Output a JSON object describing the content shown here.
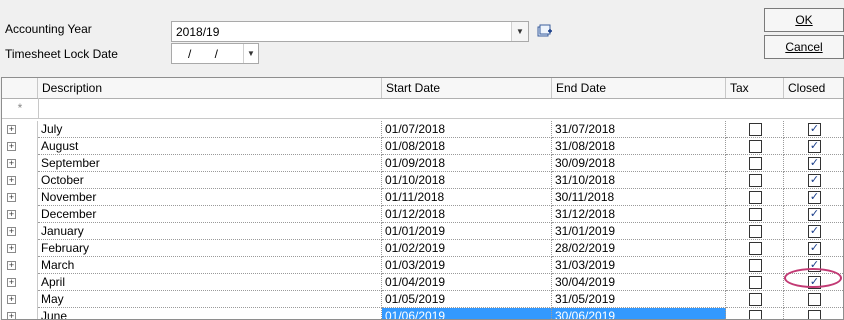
{
  "form": {
    "accounting_year_label": "Accounting Year",
    "accounting_year_value": "2018/19",
    "timesheet_lock_label": "Timesheet Lock Date",
    "timesheet_lock_value": "/ /",
    "ok_label": "OK",
    "cancel_label": "Cancel"
  },
  "grid": {
    "columns": [
      "Description",
      "Start Date",
      "End Date",
      "Tax",
      "Closed"
    ],
    "new_row_marker": "*",
    "rows": [
      {
        "description": "July",
        "start": "01/07/2018",
        "end": "31/07/2018",
        "tax": false,
        "closed": true
      },
      {
        "description": "August",
        "start": "01/08/2018",
        "end": "31/08/2018",
        "tax": false,
        "closed": true
      },
      {
        "description": "September",
        "start": "01/09/2018",
        "end": "30/09/2018",
        "tax": false,
        "closed": true
      },
      {
        "description": "October",
        "start": "01/10/2018",
        "end": "31/10/2018",
        "tax": false,
        "closed": true
      },
      {
        "description": "November",
        "start": "01/11/2018",
        "end": "30/11/2018",
        "tax": false,
        "closed": true
      },
      {
        "description": "December",
        "start": "01/12/2018",
        "end": "31/12/2018",
        "tax": false,
        "closed": true
      },
      {
        "description": "January",
        "start": "01/01/2019",
        "end": "31/01/2019",
        "tax": false,
        "closed": true
      },
      {
        "description": "February",
        "start": "01/02/2019",
        "end": "28/02/2019",
        "tax": false,
        "closed": true
      },
      {
        "description": "March",
        "start": "01/03/2019",
        "end": "31/03/2019",
        "tax": false,
        "closed": true
      },
      {
        "description": "April",
        "start": "01/04/2019",
        "end": "30/04/2019",
        "tax": false,
        "closed": true
      },
      {
        "description": "May",
        "start": "01/05/2019",
        "end": "31/05/2019",
        "tax": false,
        "closed": false
      },
      {
        "description": "June",
        "start": "01/06/2019",
        "end": "30/06/2019",
        "tax": false,
        "closed": false
      }
    ]
  },
  "colors": {
    "selection": "#3399ff",
    "highlight_circle": "#c23a74"
  },
  "icons": {
    "add_year": "add-year-icon",
    "expand": "expand-plus-icon"
  }
}
